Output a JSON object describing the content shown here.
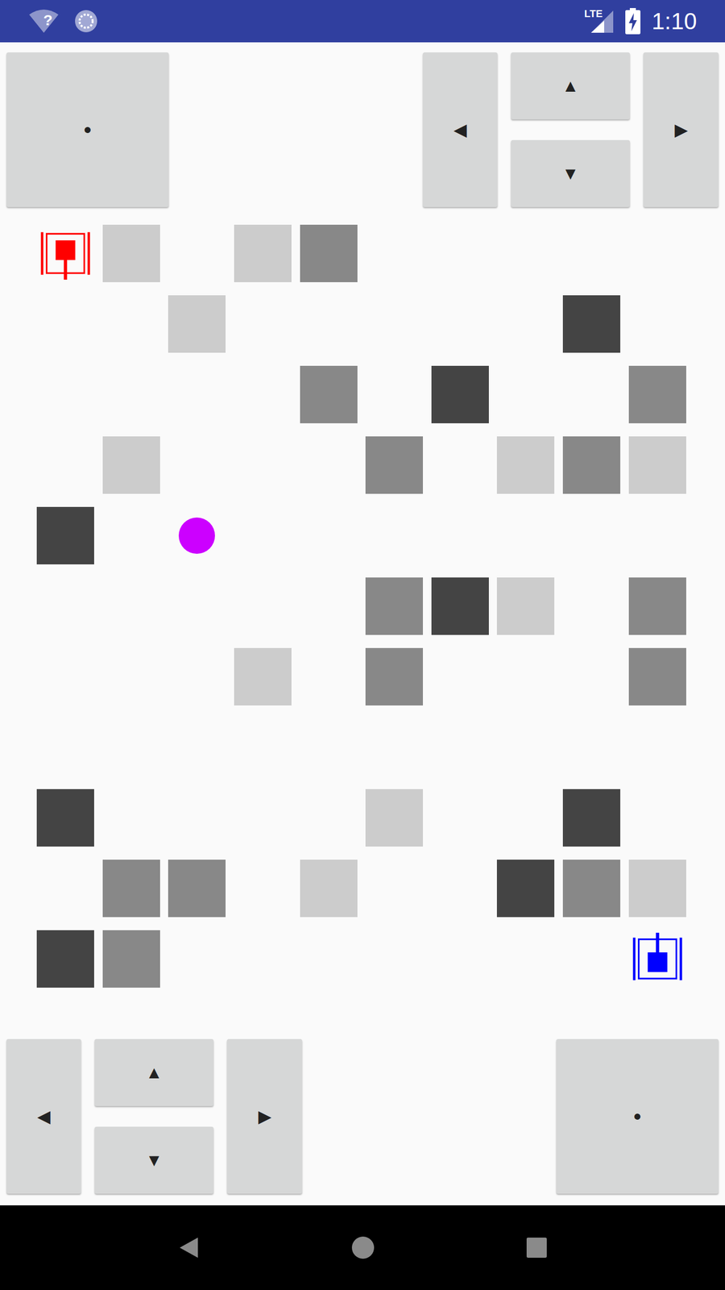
{
  "status_bar": {
    "time": "1:10",
    "network": "LTE",
    "wifi_status": "?"
  },
  "controls": {
    "top": {
      "player": "red",
      "fire": "•",
      "left": "◀",
      "up": "▲",
      "down": "▼",
      "right": "▶"
    },
    "bottom": {
      "player": "blue",
      "fire": "•",
      "left": "◀",
      "up": "▲",
      "down": "▼",
      "right": "▶"
    }
  },
  "players": [
    {
      "name": "red",
      "color": "#ff0000",
      "facing": "down"
    },
    {
      "name": "blue",
      "color": "#0000ff",
      "facing": "up"
    }
  ],
  "board": [
    [
      "red-tank",
      "light",
      "empty",
      "light",
      "medium",
      "empty",
      "empty",
      "empty",
      "empty",
      "empty"
    ],
    [
      "empty",
      "empty",
      "light",
      "empty",
      "empty",
      "empty",
      "empty",
      "empty",
      "dark",
      "empty"
    ],
    [
      "empty",
      "empty",
      "empty",
      "empty",
      "medium",
      "empty",
      "dark",
      "empty",
      "empty",
      "medium"
    ],
    [
      "empty",
      "light",
      "empty",
      "empty",
      "empty",
      "medium",
      "empty",
      "light",
      "medium",
      "light"
    ],
    [
      "dark",
      "empty",
      "ball",
      "empty",
      "empty",
      "empty",
      "empty",
      "empty",
      "empty",
      "empty"
    ],
    [
      "empty",
      "empty",
      "empty",
      "empty",
      "empty",
      "medium",
      "dark",
      "light",
      "empty",
      "medium"
    ],
    [
      "empty",
      "empty",
      "empty",
      "light",
      "empty",
      "medium",
      "empty",
      "empty",
      "empty",
      "medium"
    ],
    [
      "empty",
      "empty",
      "empty",
      "empty",
      "empty",
      "empty",
      "empty",
      "empty",
      "empty",
      "empty"
    ],
    [
      "dark",
      "empty",
      "empty",
      "empty",
      "empty",
      "light",
      "empty",
      "empty",
      "dark",
      "empty"
    ],
    [
      "empty",
      "medium",
      "medium",
      "empty",
      "light",
      "empty",
      "empty",
      "dark",
      "medium",
      "light"
    ],
    [
      "dark",
      "medium",
      "empty",
      "empty",
      "empty",
      "empty",
      "empty",
      "empty",
      "empty",
      "blue-tank"
    ]
  ],
  "ball_color": "#cc00ff"
}
